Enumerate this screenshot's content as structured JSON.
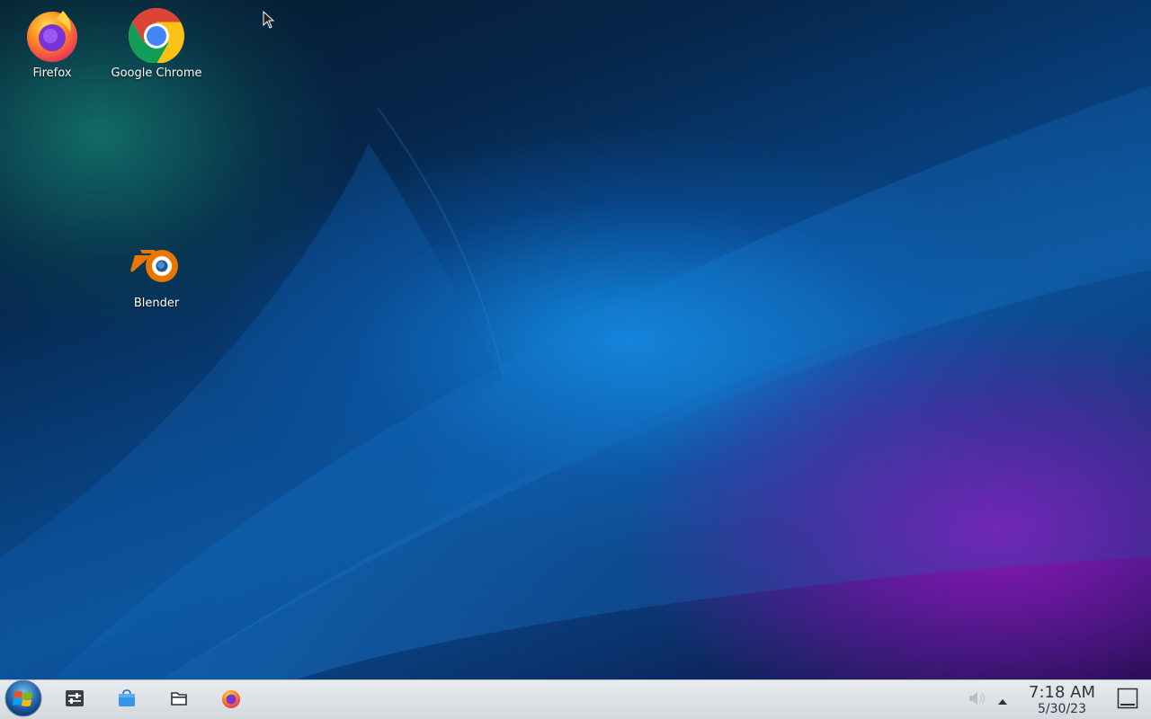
{
  "desktop": {
    "icons": [
      {
        "label": "Firefox",
        "icon": "firefox-icon"
      },
      {
        "label": "Google Chrome",
        "icon": "chrome-icon"
      },
      {
        "label": "Blender",
        "icon": "blender-icon"
      }
    ]
  },
  "taskbar": {
    "start_icon": "start-menu-icon",
    "pinned": [
      "system-settings-icon",
      "discover-store-icon",
      "file-manager-icon",
      "firefox-icon"
    ],
    "tray": {
      "volume_icon": "volume-muted-icon",
      "expand_icon": "tray-expand-arrow-icon"
    },
    "clock": {
      "time": "7:18 AM",
      "date": "5/30/23"
    },
    "show_desktop_icon": "show-desktop-icon"
  }
}
